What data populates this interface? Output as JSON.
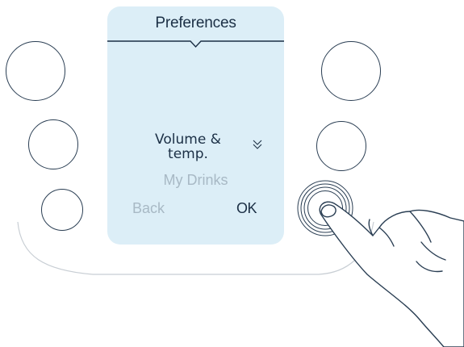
{
  "screen": {
    "title": "Preferences",
    "menu_current": "Volume & temp.",
    "menu_next": "My Drinks",
    "softkey_left": "Back",
    "softkey_right": "OK"
  },
  "icons": {
    "scroll": "double-chevron-down-icon",
    "title_pointer": "caret-down-icon"
  },
  "hardware_buttons": {
    "left": [
      "top-left",
      "middle-left",
      "bottom-left"
    ],
    "right": [
      "top-right",
      "middle-right",
      "bottom-right"
    ],
    "pressed": "bottom-right"
  },
  "colors": {
    "screen_bg": "#dceef7",
    "text_primary": "#1b2f45",
    "text_muted": "#a8b9c5",
    "outline": "#2a3e53"
  }
}
